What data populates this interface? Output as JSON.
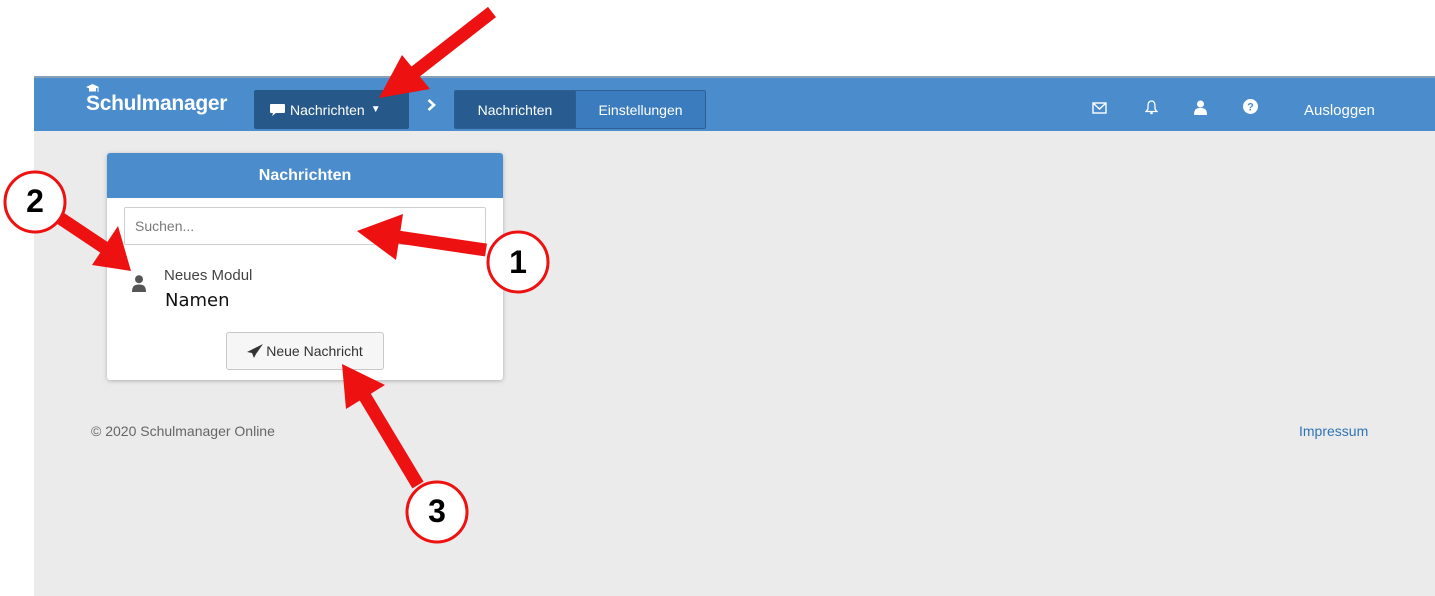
{
  "topbar": {
    "brand": "Schulmanager",
    "module_dropdown": "Nachrichten",
    "tabs": [
      {
        "label": "Nachrichten",
        "active": true
      },
      {
        "label": "Einstellungen",
        "active": false
      }
    ],
    "icons": [
      "envelope-icon",
      "bell-icon",
      "user-icon",
      "help-icon"
    ],
    "logout": "Ausloggen"
  },
  "panel": {
    "title": "Nachrichten",
    "search_placeholder": "Suchen...",
    "item": {
      "title": "Neues Modul",
      "name": "Namen"
    },
    "new_message_button": "Neue Nachricht"
  },
  "footer": {
    "copyright": "© 2020 Schulmanager Online",
    "impressum": "Impressum"
  },
  "annotations": {
    "labels": [
      "1",
      "2",
      "3"
    ]
  },
  "colors": {
    "nav": "#4a8ccc",
    "nav_dark": "#26588a",
    "background": "#ebebeb",
    "annotation_arrow": "#ee1111",
    "link": "#2f73b7"
  }
}
